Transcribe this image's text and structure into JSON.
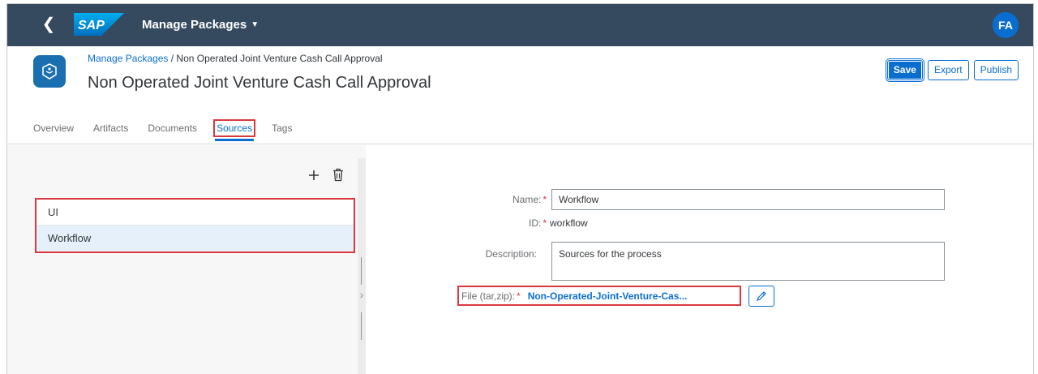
{
  "shell": {
    "app_title": "Manage Packages",
    "logo_text": "SAP",
    "avatar_initials": "FA"
  },
  "header": {
    "breadcrumb_link": "Manage Packages",
    "breadcrumb_separator": " / ",
    "breadcrumb_current": "Non Operated Joint Venture Cash Call Approval",
    "title": "Non Operated Joint Venture Cash Call Approval",
    "actions": {
      "save": "Save",
      "export": "Export",
      "publish": "Publish"
    },
    "tabs": [
      {
        "label": "Overview"
      },
      {
        "label": "Artifacts"
      },
      {
        "label": "Documents"
      },
      {
        "label": "Sources"
      },
      {
        "label": "Tags"
      }
    ]
  },
  "sources": {
    "items": [
      {
        "label": "UI"
      },
      {
        "label": "Workflow"
      }
    ]
  },
  "detail": {
    "name_label": "Name:",
    "name_value": "Workflow",
    "id_label": "ID:",
    "id_value": "workflow",
    "description_label": "Description:",
    "description_value": "Sources for the process",
    "file_label": "File (tar,zip):",
    "file_value": "Non-Operated-Joint-Venture-Cas...",
    "required_marker": "*"
  },
  "colors": {
    "shell": "#354a5f",
    "accent": "#0a6ed1",
    "highlight": "#d9393e"
  },
  "icons": {
    "back": "chevron-left-icon",
    "add": "plus-icon",
    "delete": "trash-icon",
    "edit": "pencil-icon",
    "expand": "chevron-right-icon",
    "object": "package-icon"
  }
}
